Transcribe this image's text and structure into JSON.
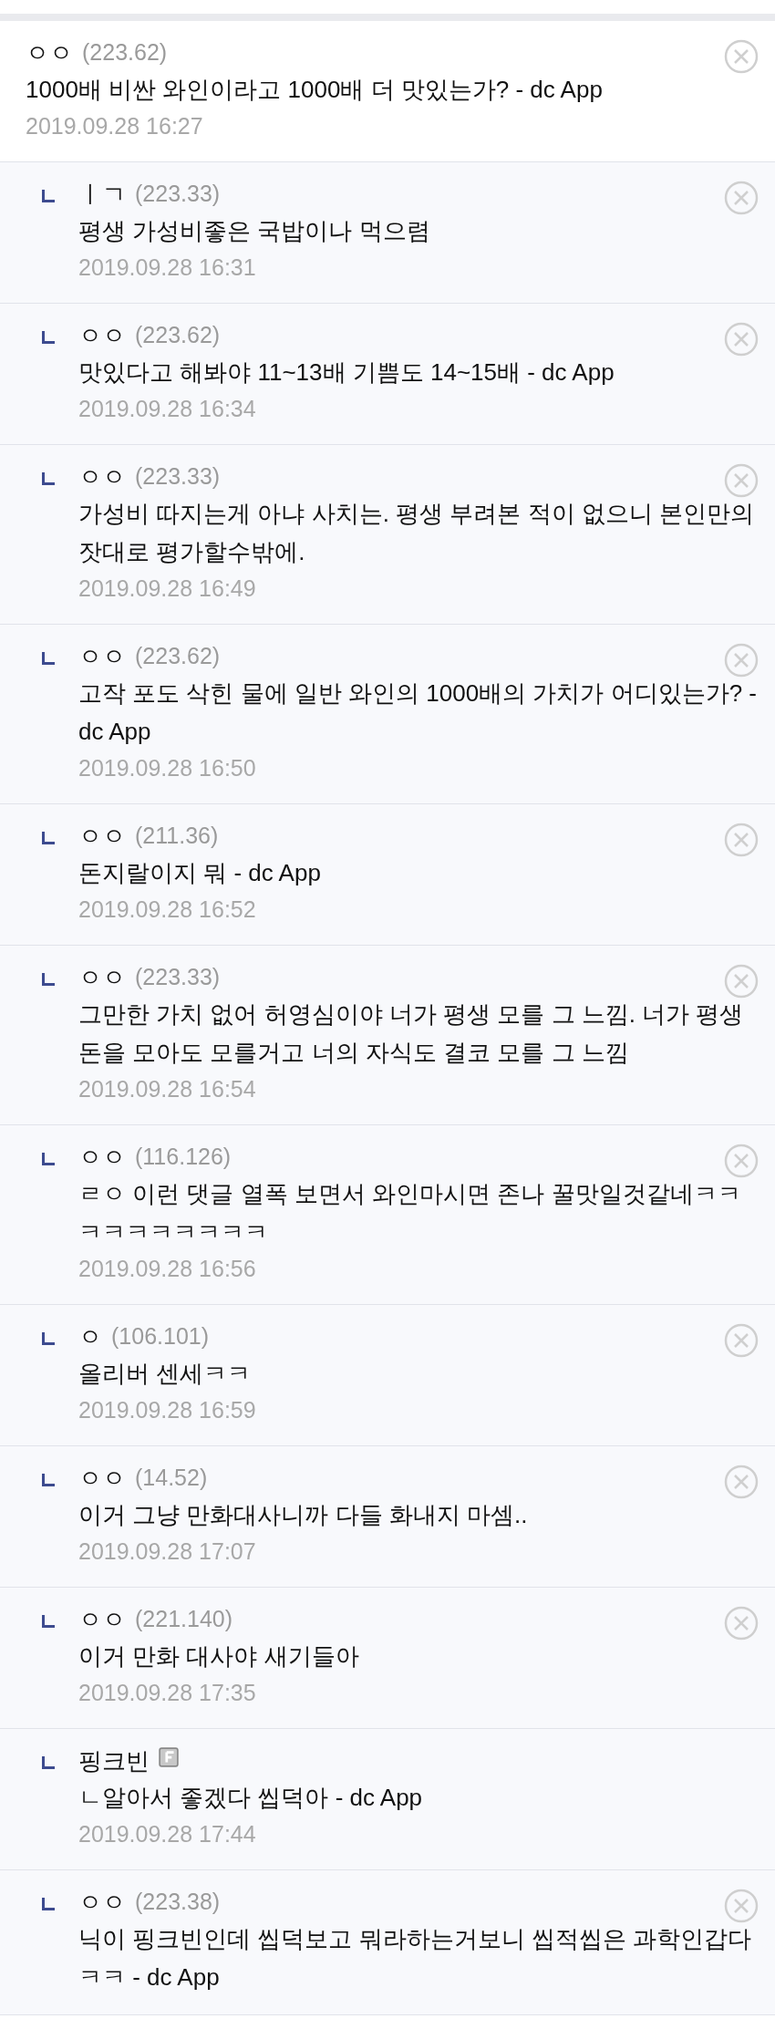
{
  "comments": [
    {
      "kind": "comment",
      "author": "ㅇㅇ",
      "ip": "(223.62)",
      "text": "1000배 비싼 와인이라고 1000배 더 맛있는가? - dc App",
      "date": "2019.09.28 16:27",
      "deletable": true,
      "member": false
    },
    {
      "kind": "reply",
      "author": "ㅣㄱ",
      "ip": "(223.33)",
      "text": "평생 가성비좋은 국밥이나 먹으렴",
      "date": "2019.09.28 16:31",
      "deletable": true,
      "member": false
    },
    {
      "kind": "reply",
      "author": "ㅇㅇ",
      "ip": "(223.62)",
      "text": "맛있다고 해봐야 11~13배 기쁨도 14~15배 - dc App",
      "date": "2019.09.28 16:34",
      "deletable": true,
      "member": false
    },
    {
      "kind": "reply",
      "author": "ㅇㅇ",
      "ip": "(223.33)",
      "text": "가성비 따지는게 아냐 사치는. 평생 부려본 적이 없으니 본인만의 잣대로 평가할수밖에.",
      "date": "2019.09.28 16:49",
      "deletable": true,
      "member": false
    },
    {
      "kind": "reply",
      "author": "ㅇㅇ",
      "ip": "(223.62)",
      "text": "고작 포도 삭힌 물에 일반 와인의 1000배의 가치가 어디있는가? - dc App",
      "date": "2019.09.28 16:50",
      "deletable": true,
      "member": false
    },
    {
      "kind": "reply",
      "author": "ㅇㅇ",
      "ip": "(211.36)",
      "text": "돈지랄이지 뭐 - dc App",
      "date": "2019.09.28 16:52",
      "deletable": true,
      "member": false
    },
    {
      "kind": "reply",
      "author": "ㅇㅇ",
      "ip": "(223.33)",
      "text": "그만한 가치 없어 허영심이야 너가 평생 모를 그 느낌. 너가 평생 돈을 모아도 모를거고 너의 자식도 결코 모를 그 느낌",
      "date": "2019.09.28 16:54",
      "deletable": true,
      "member": false
    },
    {
      "kind": "reply",
      "author": "ㅇㅇ",
      "ip": "(116.126)",
      "text": "ㄹㅇ 이런 댓글 열폭 보면서 와인마시면 존나 꿀맛일것같네ㅋㅋㅋㅋㅋㅋㅋㅋㅋㅋ",
      "date": "2019.09.28 16:56",
      "deletable": true,
      "member": false
    },
    {
      "kind": "reply",
      "author": "ㅇ",
      "ip": "(106.101)",
      "text": "올리버 센세ㅋㅋ",
      "date": "2019.09.28 16:59",
      "deletable": true,
      "member": false
    },
    {
      "kind": "reply",
      "author": "ㅇㅇ",
      "ip": "(14.52)",
      "text": "이거 그냥 만화대사니까 다들 화내지 마셈..",
      "date": "2019.09.28 17:07",
      "deletable": true,
      "member": false
    },
    {
      "kind": "reply",
      "author": "ㅇㅇ",
      "ip": "(221.140)",
      "text": "이거 만화 대사야 새기들아",
      "date": "2019.09.28 17:35",
      "deletable": true,
      "member": false
    },
    {
      "kind": "reply",
      "author": "핑크빈",
      "text": "ㄴ알아서 좋겠다 씹덕아 - dc App",
      "date": "2019.09.28 17:44",
      "deletable": false,
      "member": true
    },
    {
      "kind": "reply",
      "author": "ㅇㅇ",
      "ip": "(223.38)",
      "text": "닉이 핑크빈인데 씹덕보고 뭐라하는거보니 씹적씹은 과학인갑다 ㅋㅋ - dc App",
      "deletable": true,
      "member": false
    }
  ]
}
